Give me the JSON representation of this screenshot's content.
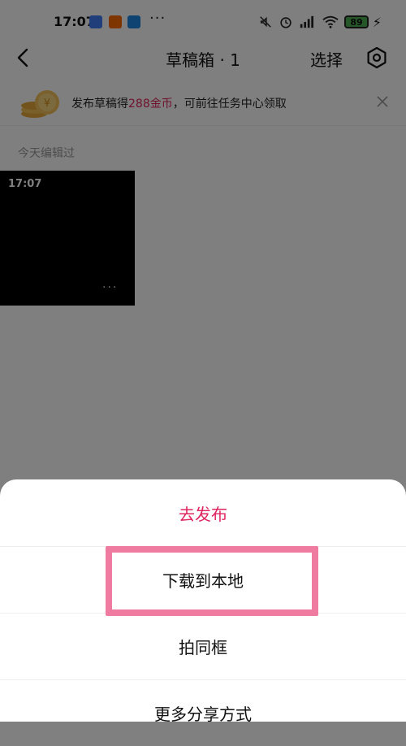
{
  "status": {
    "time": "17:07",
    "battery": "89",
    "dots": "···",
    "icons": [
      "play-app-icon",
      "mi-app-icon",
      "feishu-app-icon",
      "mute-icon",
      "alarm-icon",
      "signal-icon",
      "wifi-icon",
      "battery-icon",
      "charging-icon"
    ]
  },
  "header": {
    "title": "草稿箱 · 1",
    "select_label": "选择"
  },
  "banner": {
    "text_before": "发布草稿得",
    "highlight": "288金币",
    "text_after": "，可前往任务中心领取"
  },
  "section": {
    "label": "今天编辑过"
  },
  "draft": {
    "time": "17:07",
    "more": "···"
  },
  "sheet": {
    "options": [
      "去发布",
      "下载到本地",
      "拍同框",
      "更多分享方式"
    ]
  },
  "colors": {
    "accent": "#e0245e",
    "highlight_box": "#f07ba0"
  }
}
